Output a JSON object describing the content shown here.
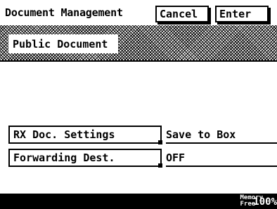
{
  "header": {
    "title": "Document Management",
    "cancel_label": "Cancel",
    "enter_label": "Enter"
  },
  "document_type": "Public Document",
  "settings": [
    {
      "label": "RX Doc. Settings",
      "value": "Save to Box"
    },
    {
      "label": "Forwarding Dest.",
      "value": "OFF"
    }
  ],
  "status": {
    "memory_label_line1": "Memory",
    "memory_label_line2": "Free",
    "memory_free": "100%"
  }
}
